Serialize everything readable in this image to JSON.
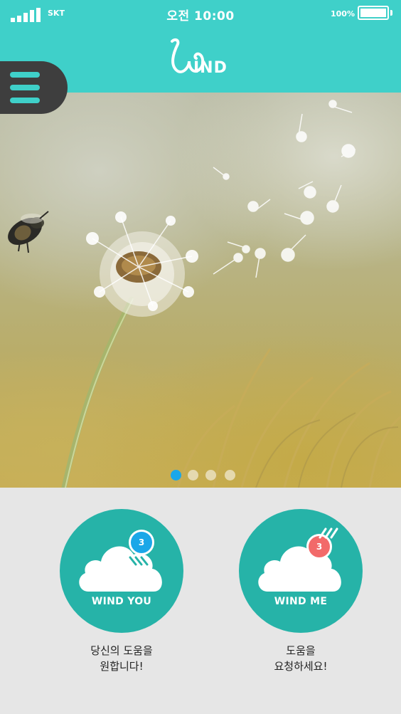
{
  "status_bar": {
    "carrier": "SKT",
    "time": "오전 10:00",
    "battery": "100%"
  },
  "header": {
    "logo_text": "IND",
    "icons": {
      "menu": "hamburger-menu-icon",
      "logo": "wind-logo-icon"
    }
  },
  "carousel": {
    "slide_count": 4,
    "active_index": 0
  },
  "actions": [
    {
      "label": "WIND YOU",
      "badge": "3",
      "badge_color": "#1aa7e8",
      "caption_line1": "당신의 도움을",
      "caption_line2": "원합니다!"
    },
    {
      "label": "WIND ME",
      "badge": "3",
      "badge_color": "#f26a6a",
      "caption_line1": "도움을",
      "caption_line2": "요청하세요!"
    }
  ],
  "colors": {
    "accent": "#3fd0c9",
    "button_circle": "#26b3a8",
    "menu_bg": "#3e3e3e",
    "dot_active": "#1aa7e8"
  }
}
